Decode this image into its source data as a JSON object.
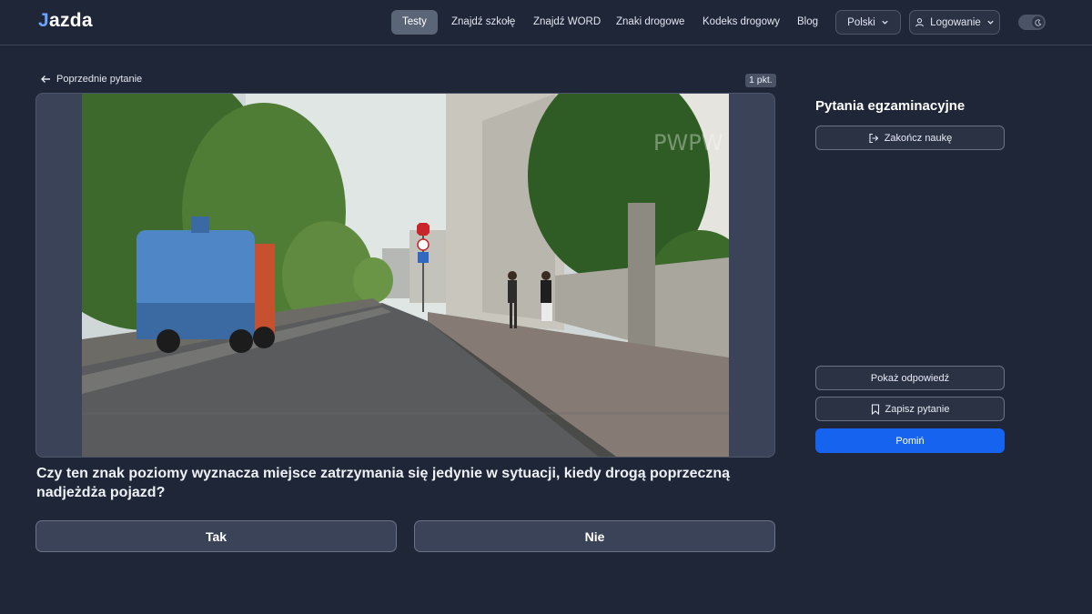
{
  "brand": {
    "logo_mark": "J",
    "logo_text": "azda"
  },
  "nav": {
    "items": [
      {
        "label": "Testy",
        "active": true
      },
      {
        "label": "Znajdź szkołę",
        "active": false
      },
      {
        "label": "Znajdź WORD",
        "active": false
      },
      {
        "label": "Znaki drogowe",
        "active": false
      },
      {
        "label": "Kodeks drogowy",
        "active": false
      },
      {
        "label": "Blog",
        "active": false
      }
    ],
    "language": "Polski",
    "login": "Logowanie",
    "theme_icon": "moon-icon"
  },
  "question_view": {
    "back_label": "Poprzednie pytanie",
    "points": "1 pkt.",
    "media_watermark": "PWPW",
    "question_text": "Czy ten znak poziomy wyznacza miejsce zatrzymania się jedynie w sytuacji, kiedy drogą poprzeczną nadjeżdża pojazd?",
    "answers": [
      "Tak",
      "Nie"
    ]
  },
  "sidebar": {
    "title": "Pytania egzaminacyjne",
    "end_label": "Zakończ naukę",
    "show_answer": "Pokaż odpowiedź",
    "save_question": "Zapisz pytanie",
    "skip": "Pomiń"
  },
  "colors": {
    "background": "#1f2637",
    "accent": "#1663f0",
    "card": "#3a4357"
  }
}
